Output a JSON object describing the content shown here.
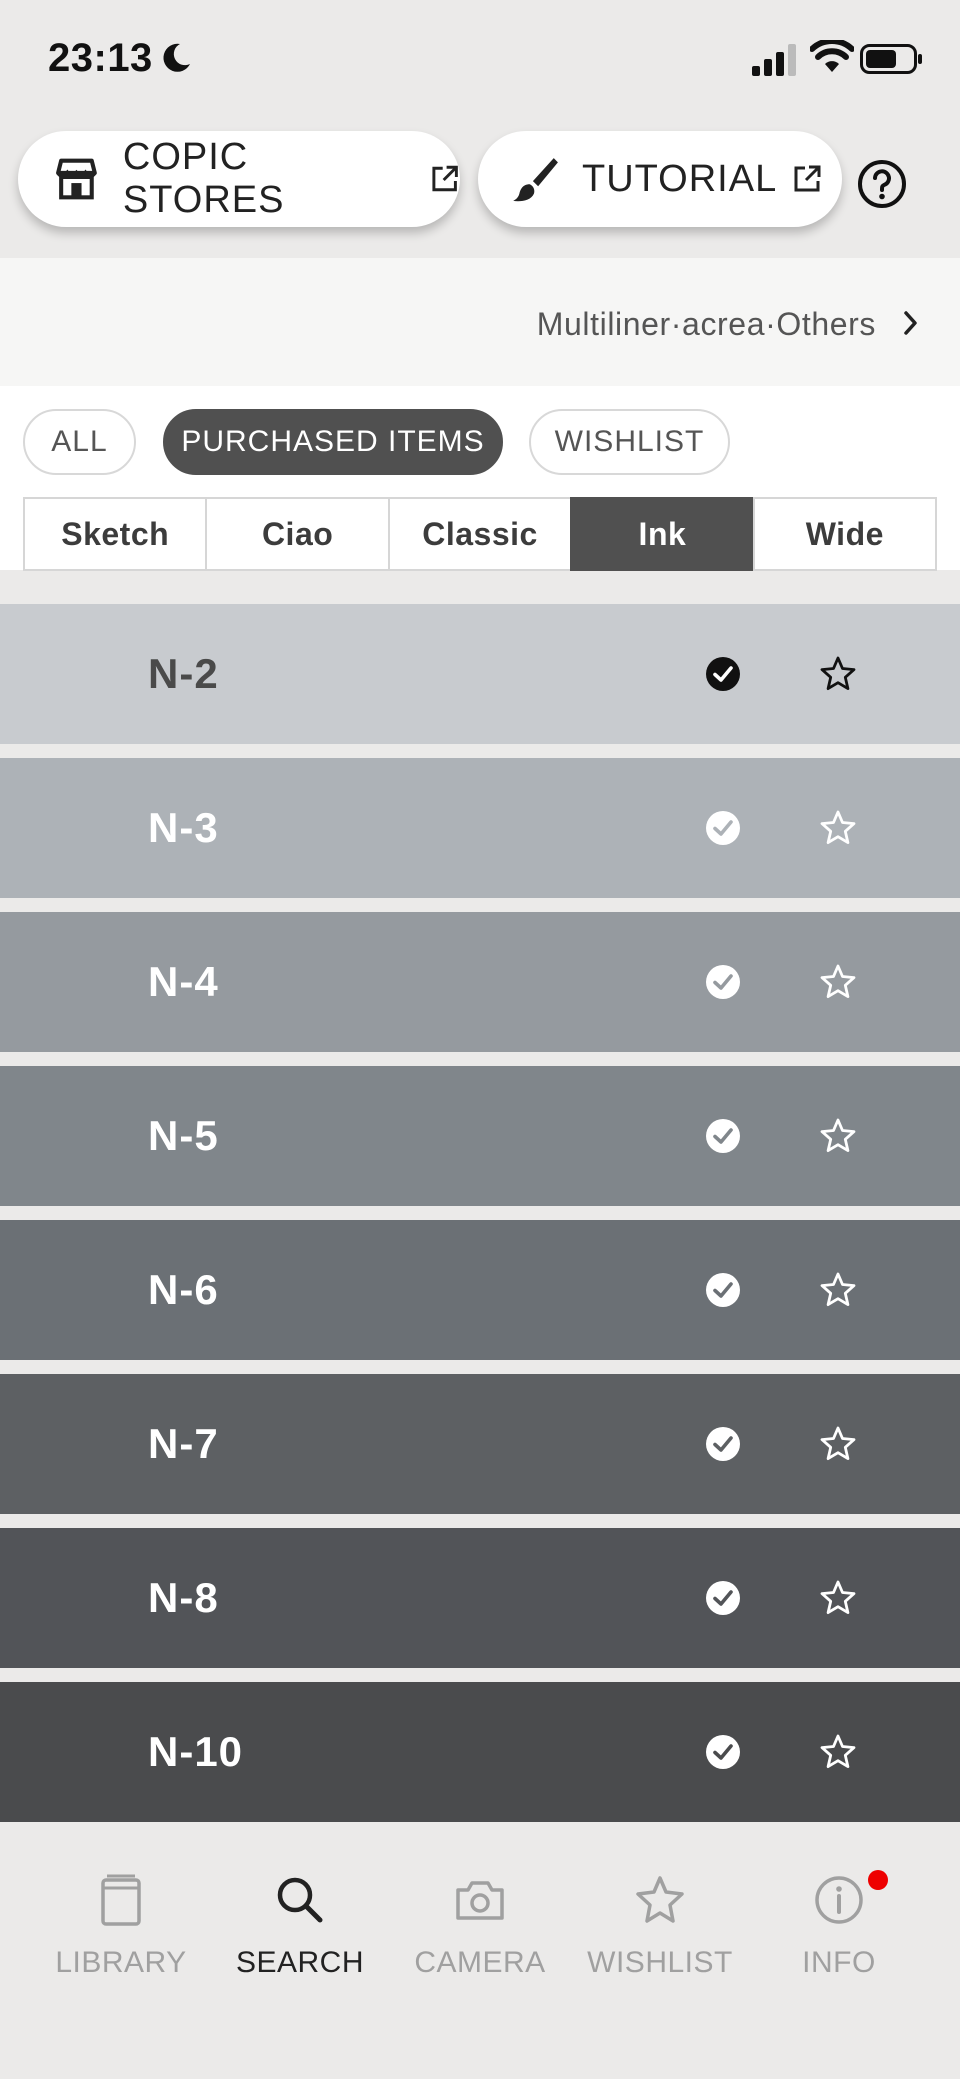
{
  "status": {
    "time": "23:13"
  },
  "top_buttons": {
    "stores_label": "COPIC STORES",
    "tutorial_label": "TUTORIAL"
  },
  "collection": {
    "breadcrumb": "Multiliner·acrea·Others"
  },
  "filters": {
    "chips": [
      {
        "label": "ALL",
        "selected": false
      },
      {
        "label": "PURCHASED ITEMS",
        "selected": true
      },
      {
        "label": "WISHLIST",
        "selected": false
      }
    ],
    "segments": [
      {
        "label": "Sketch",
        "active": false
      },
      {
        "label": "Ciao",
        "active": false
      },
      {
        "label": "Classic",
        "active": false
      },
      {
        "label": "Ink",
        "active": true
      },
      {
        "label": "Wide",
        "active": false
      }
    ]
  },
  "colors": [
    {
      "name": "N-2",
      "hex": "#c8cbcf",
      "text_color": "#4a4a4a",
      "checked_dark": true
    },
    {
      "name": "N-3",
      "hex": "#adb2b7",
      "text_color": "#ffffff",
      "checked_dark": false
    },
    {
      "name": "N-4",
      "hex": "#959a9f",
      "text_color": "#ffffff",
      "checked_dark": false
    },
    {
      "name": "N-5",
      "hex": "#80868b",
      "text_color": "#ffffff",
      "checked_dark": false
    },
    {
      "name": "N-6",
      "hex": "#6b7075",
      "text_color": "#ffffff",
      "checked_dark": false
    },
    {
      "name": "N-7",
      "hex": "#5d6063",
      "text_color": "#ffffff",
      "checked_dark": false
    },
    {
      "name": "N-8",
      "hex": "#525458",
      "text_color": "#ffffff",
      "checked_dark": false
    },
    {
      "name": "N-10",
      "hex": "#4a4b4d",
      "text_color": "#ffffff",
      "checked_dark": false
    }
  ],
  "nav": {
    "items": [
      {
        "label": "LIBRARY",
        "icon": "library-icon",
        "active": false
      },
      {
        "label": "SEARCH",
        "icon": "search-icon",
        "active": true
      },
      {
        "label": "CAMERA",
        "icon": "camera-icon",
        "active": false
      },
      {
        "label": "WISHLIST",
        "icon": "star-icon",
        "active": false
      },
      {
        "label": "INFO",
        "icon": "info-icon",
        "active": false
      }
    ]
  },
  "colors_ui": {
    "accent_dark": "#505050",
    "badge": "#e00000"
  }
}
